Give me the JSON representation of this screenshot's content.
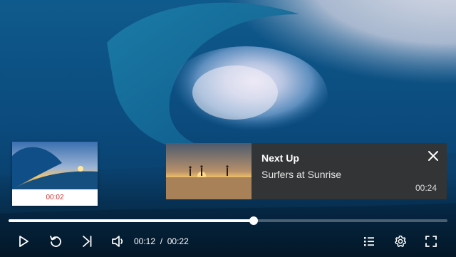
{
  "player": {
    "current_time": "00:12",
    "time_separator": "/",
    "total_time": "00:22",
    "progress_fraction": 0.558
  },
  "scrub_preview": {
    "time": "00:02"
  },
  "next_up": {
    "heading": "Next Up",
    "title": "Surfers at Sunrise",
    "duration": "00:24"
  },
  "icons": {
    "play": "play-icon",
    "replay": "replay-icon",
    "next": "skip-next-icon",
    "volume": "volume-icon",
    "playlist": "playlist-icon",
    "settings": "gear-icon",
    "fullscreen": "fullscreen-icon",
    "close": "close-icon"
  },
  "colors": {
    "preview_time": "#cc3333",
    "card_bg": "#343434"
  }
}
